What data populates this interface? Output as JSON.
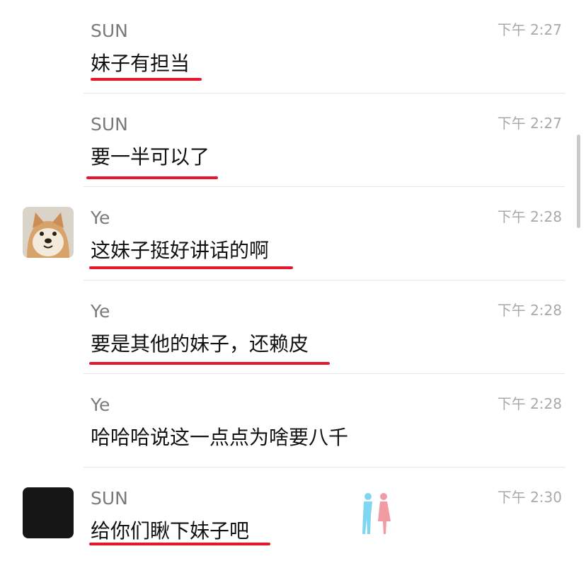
{
  "messages": [
    {
      "sender": "SUN",
      "time": "下午 2:27",
      "text": "妹子有担当",
      "avatar": "none"
    },
    {
      "sender": "SUN",
      "time": "下午 2:27",
      "text": "要一半可以了",
      "avatar": "none"
    },
    {
      "sender": "Ye",
      "time": "下午 2:28",
      "text": "这妹子挺好讲话的啊",
      "avatar": "shiba-dog-avatar"
    },
    {
      "sender": "Ye",
      "time": "下午 2:28",
      "text": "要是其他的妹子，还赖皮",
      "avatar": "none"
    },
    {
      "sender": "Ye",
      "time": "下午 2:28",
      "text": "哈哈哈说这一点点为啥要八千",
      "avatar": "none"
    },
    {
      "sender": "SUN",
      "time": "下午 2:30",
      "text": "给你们瞅下妹子吧",
      "avatar": "black-avatar"
    }
  ],
  "colors": {
    "underline": "#e4172d",
    "sender": "#7a7a7a",
    "time": "#a9a9a9",
    "text": "#111111"
  },
  "icons": {
    "watermark": "couple-silhouette-icon"
  }
}
